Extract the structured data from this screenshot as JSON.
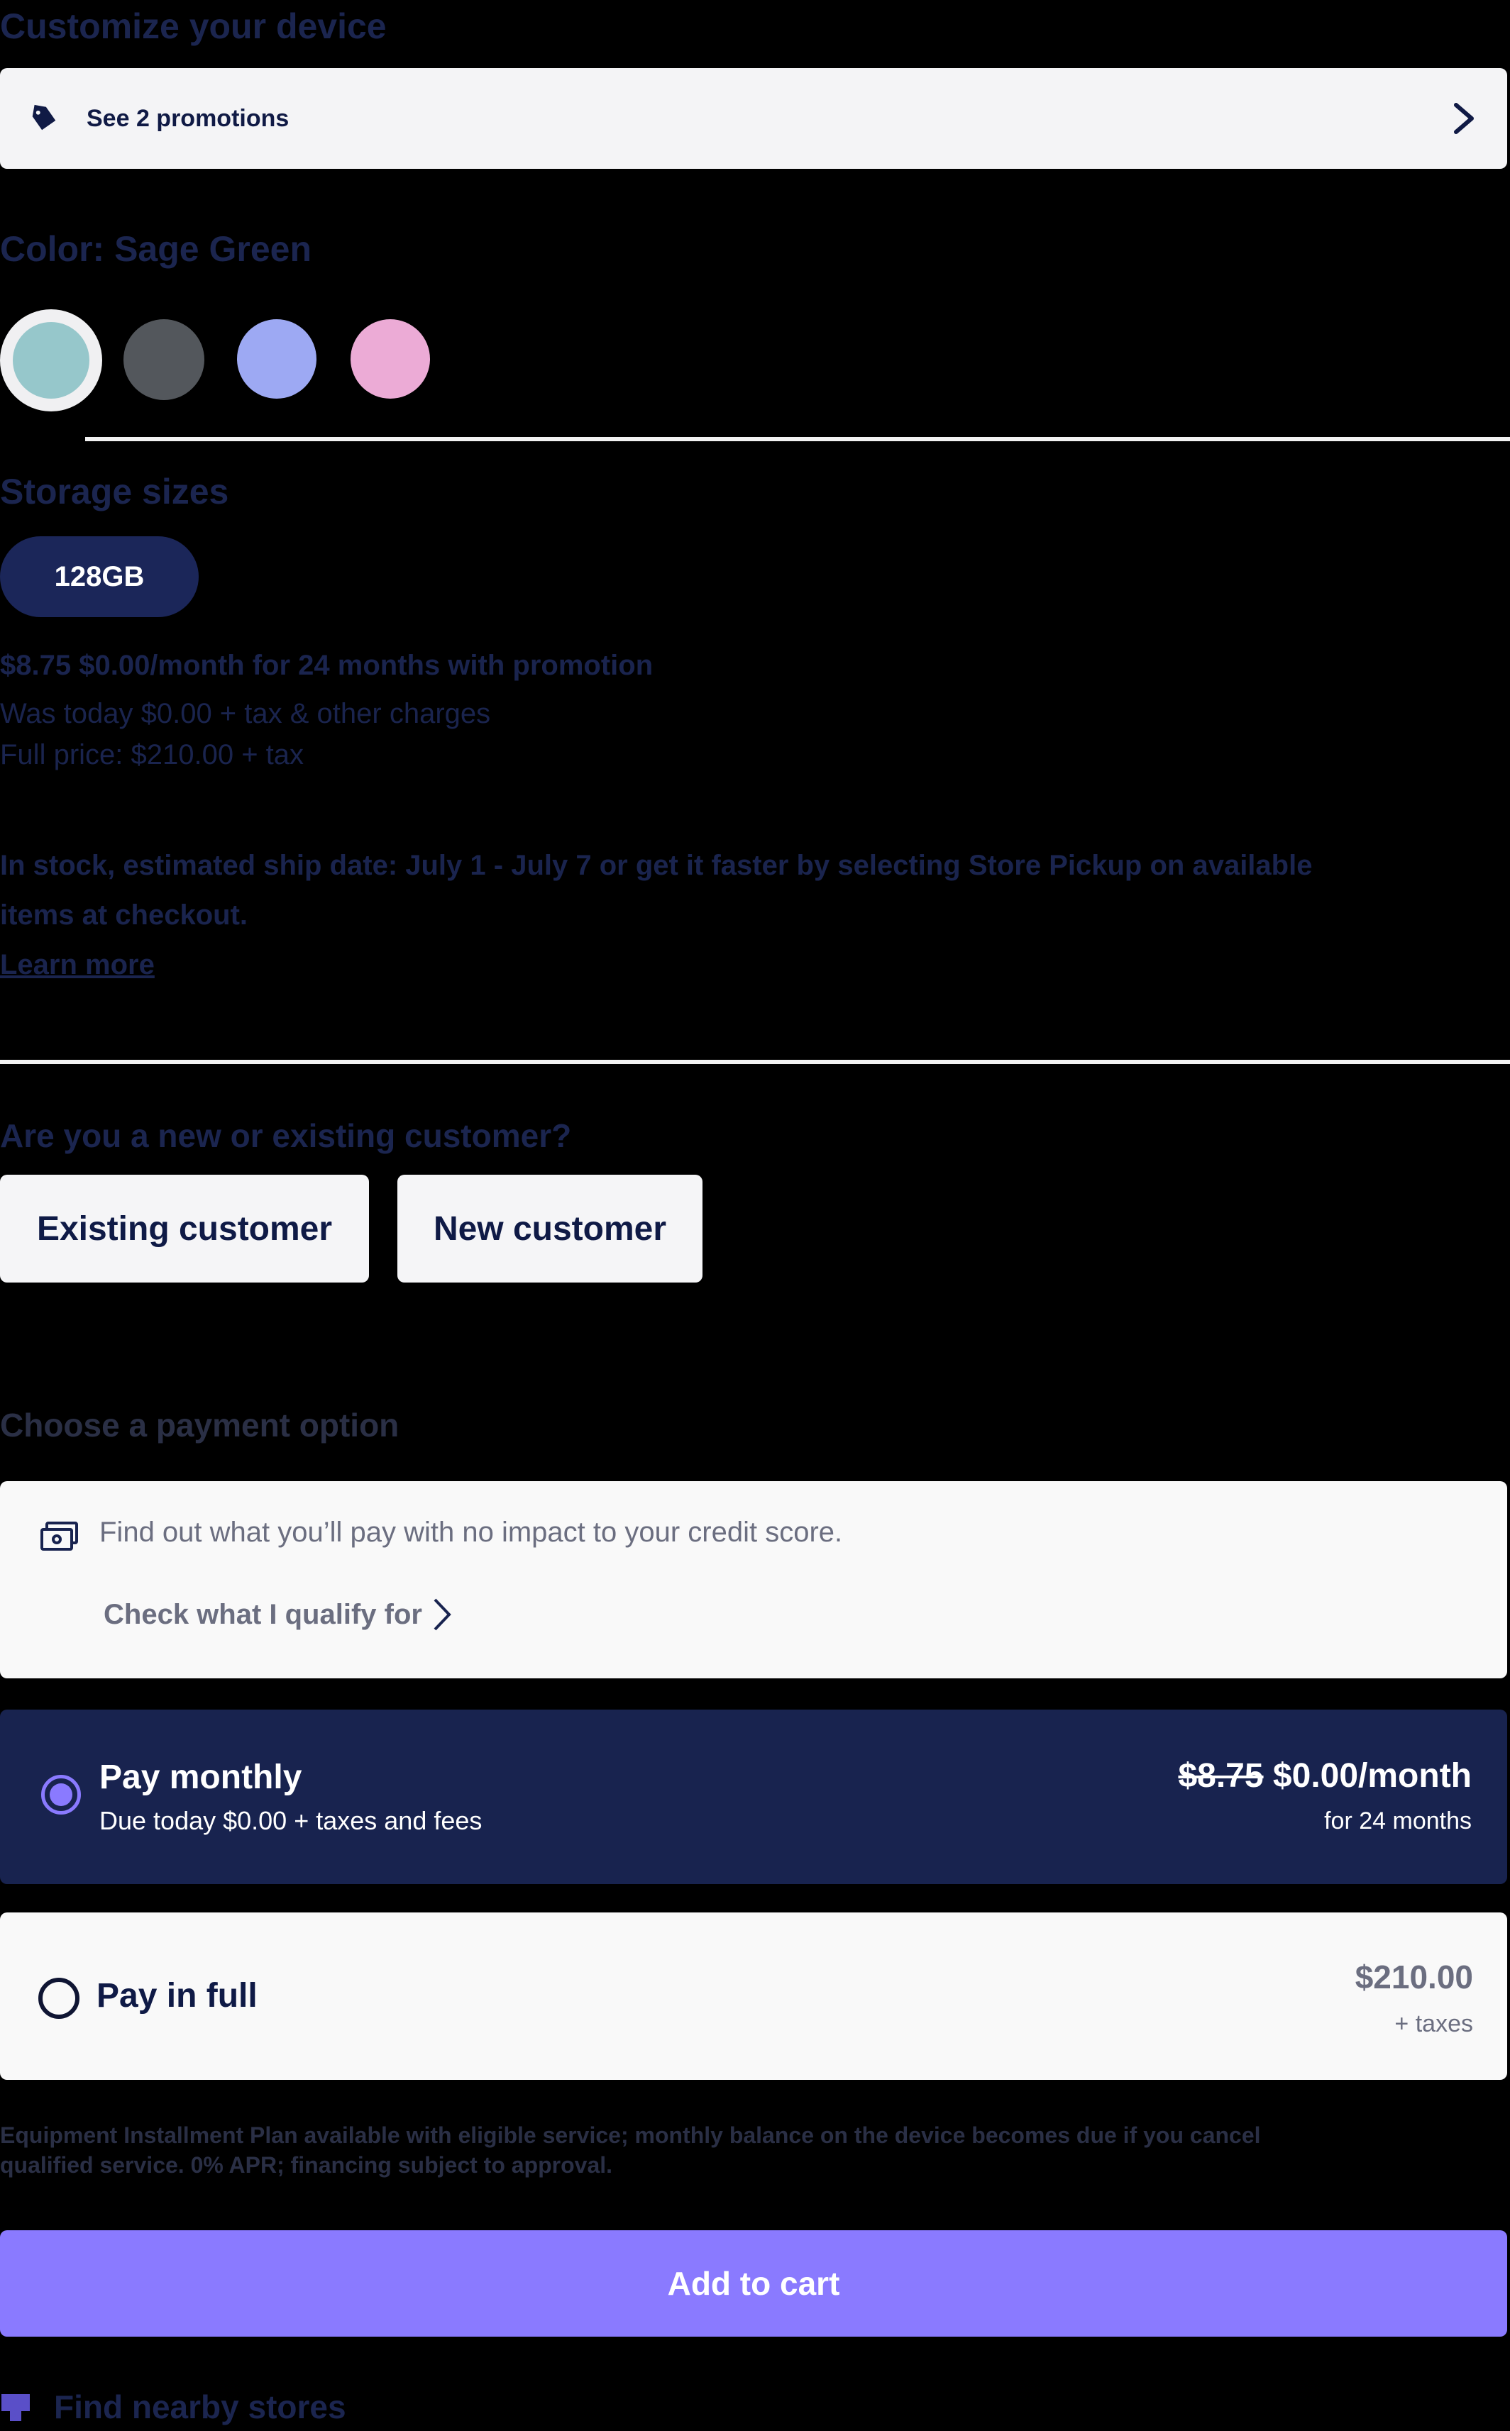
{
  "header": {
    "title": "Customize your device"
  },
  "promotions": {
    "label": "See 2 promotions"
  },
  "color": {
    "label": "Color: Sage Green",
    "options": [
      "Sage Green",
      "Gray",
      "Periwinkle",
      "Pink"
    ],
    "selected": "Sage Green",
    "swatch_colors": [
      "#96C7CB",
      "#53575C",
      "#9DA9F3",
      "#ECABD6"
    ]
  },
  "storage": {
    "label": "Storage sizes",
    "selected": "128GB"
  },
  "pricing": {
    "line1": "$8.75 $0.00/month for 24 months with promotion",
    "line2": "Was today $0.00 + tax & other charges",
    "line3": "Full price: $210.00 + tax"
  },
  "shipping": {
    "line1": "In stock, estimated ship date: July 1 - July 7 or get it faster by selecting Store Pickup on available",
    "line2": "items at checkout.",
    "learn_more": "Learn more"
  },
  "customer_type": {
    "question": "Are you a new or existing customer?",
    "existing": "Existing customer",
    "new": "New customer"
  },
  "payment": {
    "heading": "Choose a payment option",
    "credit_text": "Find out what you’ll pay with no impact to your credit score.",
    "credit_link": "Check what I qualify for",
    "monthly": {
      "title": "Pay monthly",
      "due_today": "Due today $0.00 + taxes and fees",
      "old_price": "$8.75",
      "price": "$0.00/month",
      "term": "for 24 months"
    },
    "full": {
      "title": "Pay in full",
      "price": "$210.00",
      "taxes": "+ taxes"
    }
  },
  "disclaimer": {
    "line1": "Equipment Installment Plan available with eligible service; monthly balance on the device becomes due if you cancel",
    "line2": "qualified service. 0% APR; financing subject to approval."
  },
  "actions": {
    "add_to_cart": "Add to cart",
    "find_stores": "Find nearby stores"
  },
  "colors": {
    "navy": "#18234F",
    "accent_purple": "#8A7AFF",
    "card_light": "#F9F9F9"
  }
}
